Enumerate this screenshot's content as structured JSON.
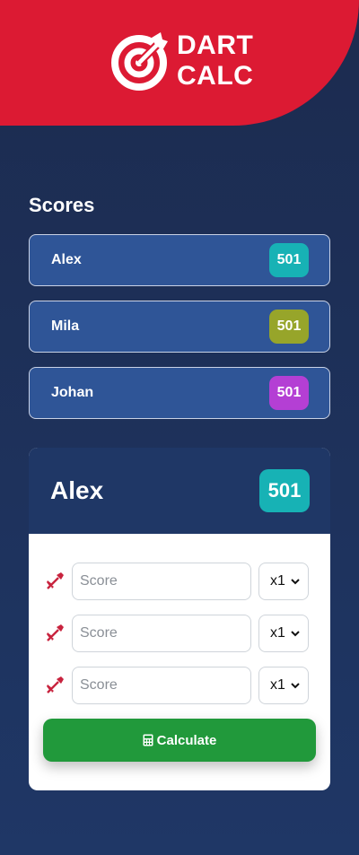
{
  "app": {
    "title_line1": "DART",
    "title_line2": "CALC",
    "logo_icon": "bullseye-arrow-icon",
    "brand_color": "#dc1a33"
  },
  "scores": {
    "title": "Scores",
    "players": [
      {
        "name": "Alex",
        "score": "501",
        "color": "#17b2b5"
      },
      {
        "name": "Mila",
        "score": "501",
        "color": "#97a52a"
      },
      {
        "name": "Johan",
        "score": "501",
        "color": "#b43fd4"
      }
    ]
  },
  "current": {
    "name": "Alex",
    "score": "501",
    "color": "#17b2b5"
  },
  "darts": [
    {
      "icon": "dart-icon",
      "placeholder": "Score",
      "value": "",
      "multiplier": "x1"
    },
    {
      "icon": "dart-icon",
      "placeholder": "Score",
      "value": "",
      "multiplier": "x1"
    },
    {
      "icon": "dart-icon",
      "placeholder": "Score",
      "value": "",
      "multiplier": "x1"
    }
  ],
  "calculate": {
    "label": "Calculate",
    "icon": "calculator-icon",
    "color": "#21993b"
  }
}
